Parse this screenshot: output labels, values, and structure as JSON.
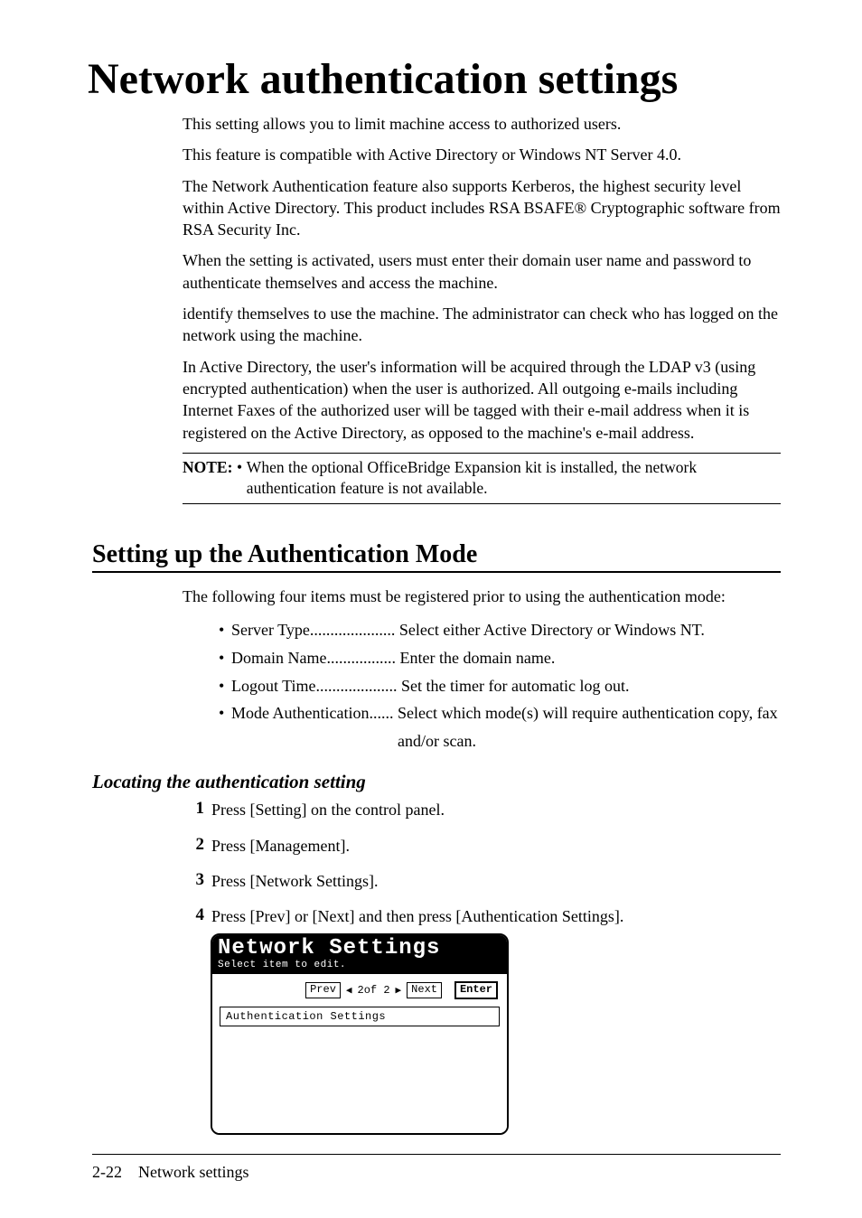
{
  "title": "Network authentication settings",
  "paragraphs": [
    "This setting allows you to limit machine access to authorized users.",
    "This feature is compatible with Active Directory or Windows NT Server 4.0.",
    "The Network Authentication feature also supports Kerberos, the highest security level within Active Directory.  This product includes RSA BSAFE® Cryptographic software from RSA Security Inc.",
    "When the setting is activated, users must enter their domain user name and password to authenticate themselves and access the machine.",
    "identify themselves to use the machine. The administrator can check who has logged on the network using the machine.",
    "In Active Directory, the user's information will be acquired through the LDAP v3 (using encrypted authentication) when the user is authorized. All outgoing e-mails including Internet Faxes of the authorized user will be tagged with their e-mail address when it is registered on the Active Directory, as opposed to the machine's e-mail address."
  ],
  "note": {
    "label": "NOTE:",
    "bullet": "•",
    "text": "When the optional OfficeBridge Expansion kit is installed, the network authentication feature is not available."
  },
  "section_title": "Setting up the Authentication Mode",
  "section_intro": "The following four items must be registered prior to using the authentication mode:",
  "bullets": [
    {
      "label": "Server Type",
      "dots": ".....................",
      "desc": "Select either Active Directory or Windows NT."
    },
    {
      "label": "Domain Name",
      "dots": ".................",
      "desc": "Enter the domain name."
    },
    {
      "label": "Logout Time",
      "dots": "....................",
      "desc": "Set the timer for automatic log out."
    },
    {
      "label": "Mode Authentication",
      "dots": "......",
      "desc": "Select which mode(s) will require authentication copy, fax and/or scan."
    }
  ],
  "subheading": "Locating the authentication setting",
  "steps": [
    "Press [Setting] on the control panel.",
    "Press [Management].",
    "Press [Network Settings].",
    "Press [Prev] or [Next] and then press [Authentication Settings]."
  ],
  "lcd": {
    "title": "Network Settings",
    "subtitle": "Select item to edit.",
    "prev": "Prev",
    "left_tri": "◀",
    "page": "2of 2",
    "right_tri": "▶",
    "next": "Next",
    "enter": "Enter",
    "item": "Authentication Settings"
  },
  "footer": {
    "page": "2-22",
    "section": "Network settings"
  }
}
